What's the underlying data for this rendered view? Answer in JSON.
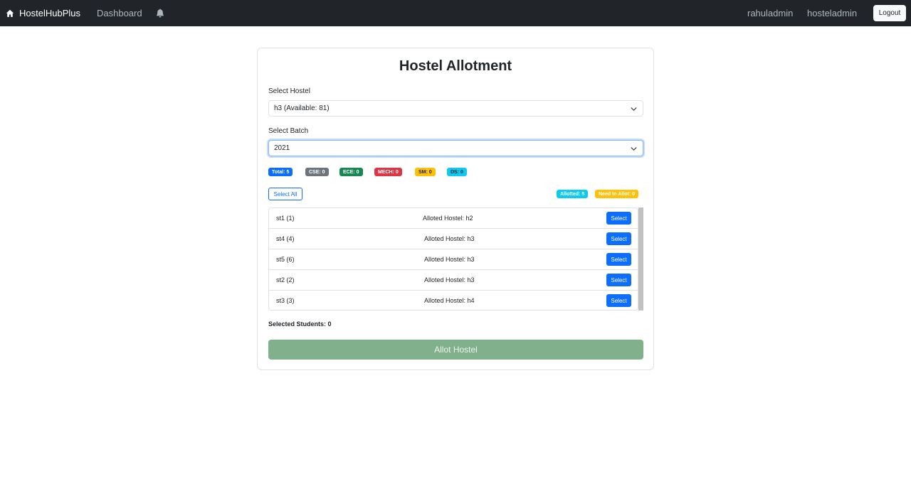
{
  "navbar": {
    "brand": "HostelHubPlus",
    "dashboard": "Dashboard",
    "user1": "rahuladmin",
    "user2": "hosteladmin",
    "logout": "Logout"
  },
  "card": {
    "title": "Hostel Allotment",
    "hostel_label": "Select Hostel",
    "hostel_value": "h3 (Available: 81)",
    "batch_label": "Select Batch",
    "batch_value": "2021"
  },
  "badges": [
    {
      "label": "Total: 5",
      "color": "#0d6efd"
    },
    {
      "label": "CSE: 0",
      "color": "#6c757d"
    },
    {
      "label": "ECE: 0",
      "color": "#198754"
    },
    {
      "label": "MECH: 0",
      "color": "#dc3545"
    },
    {
      "label": "SM: 0",
      "color": "#ffc107"
    },
    {
      "label": "DS: 0",
      "color": "#0dcaf0"
    }
  ],
  "status": {
    "allotted": "Allotted: 5",
    "need": "Need to Allot: 0"
  },
  "select_all": "Select All",
  "students": [
    {
      "name": "st1 (1)",
      "allotted": "Alloted Hostel: h2",
      "button": "Select"
    },
    {
      "name": "st4 (4)",
      "allotted": "Alloted Hostel: h3",
      "button": "Select"
    },
    {
      "name": "st5 (6)",
      "allotted": "Alloted Hostel: h3",
      "button": "Select"
    },
    {
      "name": "st2 (2)",
      "allotted": "Alloted Hostel: h3",
      "button": "Select"
    },
    {
      "name": "st3 (3)",
      "allotted": "Alloted Hostel: h4",
      "button": "Select"
    }
  ],
  "selected_students": "Selected Students: 0",
  "allot_button": "Allot Hostel",
  "icons": {
    "brand": "home-icon",
    "bell": "bell-icon",
    "dropdown": "chevron-down-icon"
  }
}
